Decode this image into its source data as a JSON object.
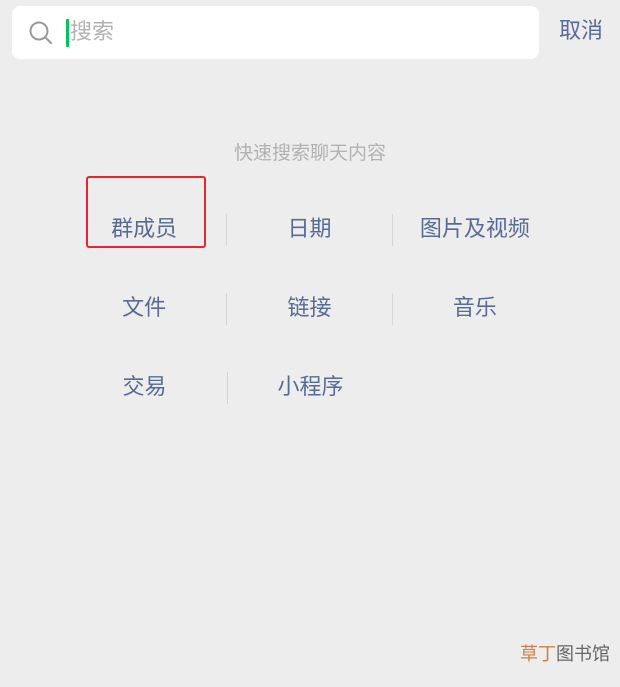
{
  "search": {
    "placeholder": "搜索",
    "value": "",
    "cancel_label": "取消"
  },
  "hint": "快速搜索聊天内容",
  "categories": [
    [
      "群成员",
      "日期",
      "图片及视频"
    ],
    [
      "文件",
      "链接",
      "音乐"
    ],
    [
      "交易",
      "小程序"
    ]
  ],
  "highlighted_category": "群成员",
  "watermark": {
    "accent": "草丁",
    "rest": "图书馆"
  },
  "colors": {
    "accent_blue": "#576b95",
    "caret_green": "#07c160",
    "highlight_red": "#e8262b",
    "background": "#ededed"
  }
}
